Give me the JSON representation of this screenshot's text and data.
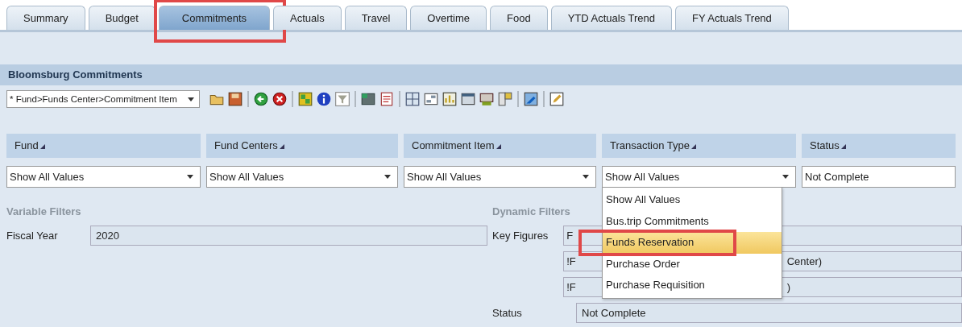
{
  "tabs": [
    {
      "label": "Summary",
      "selected": false,
      "highlighted": false
    },
    {
      "label": "Budget",
      "selected": false,
      "highlighted": false
    },
    {
      "label": "Commitments",
      "selected": true,
      "highlighted": true
    },
    {
      "label": "Actuals",
      "selected": false,
      "highlighted": false
    },
    {
      "label": "Travel",
      "selected": false,
      "highlighted": false
    },
    {
      "label": "Overtime",
      "selected": false,
      "highlighted": false
    },
    {
      "label": "Food",
      "selected": false,
      "highlighted": false
    },
    {
      "label": "YTD Actuals Trend",
      "selected": false,
      "highlighted": false
    },
    {
      "label": "FY Actuals Trend",
      "selected": false,
      "highlighted": false
    }
  ],
  "panel_title": "Bloomsburg Commitments",
  "view_select": {
    "value": "* Fund>Funds Center>Commitment Item"
  },
  "toolbar": [
    {
      "kind": "folder"
    },
    {
      "kind": "save"
    },
    {
      "kind": "sep"
    },
    {
      "kind": "back"
    },
    {
      "kind": "cancel"
    },
    {
      "kind": "sep"
    },
    {
      "kind": "grid"
    },
    {
      "kind": "info"
    },
    {
      "kind": "filter"
    },
    {
      "kind": "sep"
    },
    {
      "kind": "export"
    },
    {
      "kind": "pdf"
    },
    {
      "kind": "sep"
    },
    {
      "kind": "table"
    },
    {
      "kind": "layout"
    },
    {
      "kind": "chart"
    },
    {
      "kind": "window"
    },
    {
      "kind": "print"
    },
    {
      "kind": "panel"
    },
    {
      "kind": "sep"
    },
    {
      "kind": "image"
    },
    {
      "kind": "sep"
    },
    {
      "kind": "edit"
    }
  ],
  "filters": [
    {
      "label": "Fund",
      "value": "Show All Values",
      "dropdown": true
    },
    {
      "label": "Fund Centers",
      "value": "Show All Values",
      "dropdown": true
    },
    {
      "label": "Commitment Item",
      "value": "Show All Values",
      "dropdown": true
    },
    {
      "label": "Transaction Type",
      "value": "Show All Values",
      "dropdown": true
    },
    {
      "label": "Status",
      "value": "Not Complete",
      "dropdown": false
    }
  ],
  "variable_filters": {
    "title": "Variable Filters",
    "fields": [
      {
        "label": "Fiscal Year",
        "value": "2020"
      }
    ]
  },
  "dynamic_filters": {
    "title": "Dynamic Filters",
    "key_figures_label": "Key Figures",
    "key_figures": [
      {
        "start": "F"
      },
      {
        "start": "!F",
        "end": "Center)"
      },
      {
        "start": "!F",
        "end": ")"
      }
    ],
    "status_label": "Status",
    "status_value": "Not Complete"
  },
  "open_list": {
    "options": [
      {
        "label": "Show All Values",
        "selected": false,
        "highlighted": false
      },
      {
        "label": "Bus.trip Commitments",
        "selected": false,
        "highlighted": false
      },
      {
        "label": "Funds Reservation",
        "selected": true,
        "highlighted": true
      },
      {
        "label": "Purchase Order",
        "selected": false,
        "highlighted": false
      },
      {
        "label": "Purchase Requisition",
        "selected": false,
        "highlighted": false
      }
    ]
  }
}
